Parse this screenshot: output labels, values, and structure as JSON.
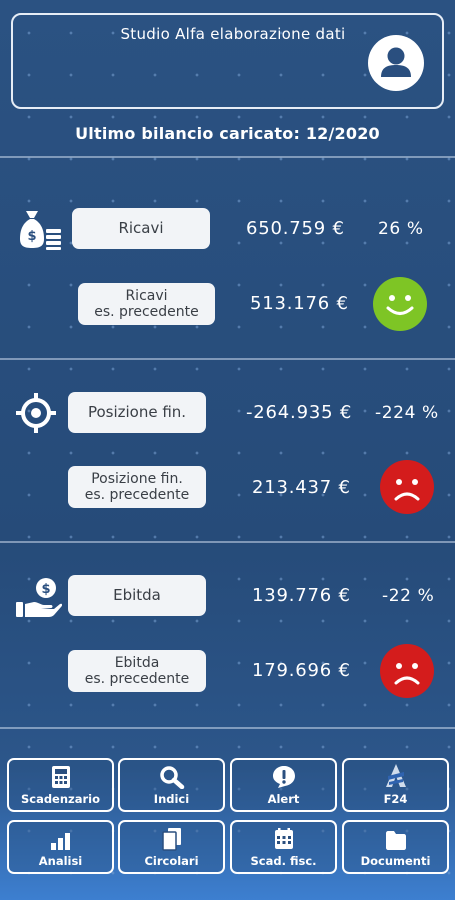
{
  "header": {
    "studio_name": "Studio Alfa elaborazione dati",
    "avatar_icon": "user-icon"
  },
  "last_balance": "Ultimo bilancio caricato: 12/2020",
  "sections": [
    {
      "icon": "money-bag-icon",
      "label": "Ricavi",
      "value": "650.759 €",
      "percent": "26 %",
      "prev_label_line1": "Ricavi",
      "prev_label_line2": "es. precedente",
      "prev_value": "513.176 €",
      "trend": "happy",
      "trend_color": "#7ec525"
    },
    {
      "icon": "target-icon",
      "label": "Posizione fin.",
      "value": "-264.935 €",
      "percent": "-224 %",
      "prev_label_line1": "Posizione fin.",
      "prev_label_line2": "es. precedente",
      "prev_value": "213.437 €",
      "trend": "sad",
      "trend_color": "#d41c1c"
    },
    {
      "icon": "hand-money-icon",
      "label": "Ebitda",
      "value": "139.776 €",
      "percent": "-22 %",
      "prev_label_line1": "Ebitda",
      "prev_label_line2": "es. precedente",
      "prev_value": "179.696 €",
      "trend": "sad",
      "trend_color": "#d41c1c"
    }
  ],
  "nav": [
    {
      "label": "Scadenzario",
      "icon": "calculator-icon"
    },
    {
      "label": "Indici",
      "icon": "magnifier-icon"
    },
    {
      "label": "Alert",
      "icon": "alert-icon"
    },
    {
      "label": "F24",
      "icon": "f24-logo-icon"
    },
    {
      "label": "Analisi",
      "icon": "bar-chart-icon"
    },
    {
      "label": "Circolari",
      "icon": "documents-icon"
    },
    {
      "label": "Scad. fisc.",
      "icon": "calendar-icon"
    },
    {
      "label": "Documenti",
      "icon": "folder-icon"
    }
  ]
}
